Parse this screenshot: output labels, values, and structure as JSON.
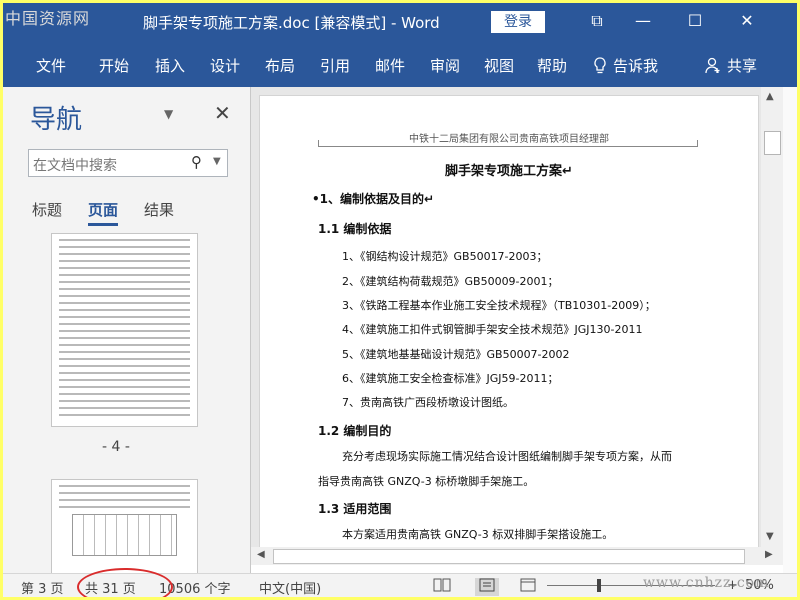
{
  "watermark_top": "中国资源网",
  "window": {
    "title": "脚手架专项施工方案.doc [兼容模式]  -  Word",
    "login": "登录",
    "buttons": {
      "restore": "⧉",
      "minimize": "—",
      "maximize": "☐",
      "close": "✕"
    }
  },
  "ribbon_tabs": [
    "文件",
    "开始",
    "插入",
    "设计",
    "布局",
    "引用",
    "邮件",
    "审阅",
    "视图",
    "帮助"
  ],
  "ribbon_right": {
    "tell_me": "告诉我",
    "share": "共享"
  },
  "nav": {
    "title": "导航",
    "search_placeholder": "在文档中搜索",
    "tabs": [
      "标题",
      "页面",
      "结果"
    ],
    "active_tab": "页面",
    "page_label": "- 4 -"
  },
  "document": {
    "header": "中铁十二局集团有限公司贵南高铁项目经理部",
    "title": "脚手架专项施工方案↵",
    "lines": [
      "•1、编制依据及目的↵",
      "1.1 编制依据",
      "1、《钢结构设计规范》GB50017-2003；",
      "2、《建筑结构荷载规范》GB50009-2001；",
      "3、《铁路工程基本作业施工安全技术规程》（TB10301-2009）；",
      "4、《建筑施工扣件式钢管脚手架安全技术规范》JGJ130-2011",
      "5、《建筑地基基础设计规范》GB50007-2002",
      "6、《建筑施工安全检查标准》JGJ59-2011；",
      "7、贵南高铁广西段桥墩设计图纸。",
      "1.2 编制目的",
      "充分考虑现场实际施工情况结合设计图纸编制脚手架专项方案，从而",
      "指导贵南高铁 GNZQ-3 标桥墩脚手架施工。",
      "1.3 适用范围",
      "本方案适用贵南高铁 GNZQ-3 标双排脚手架搭设施工。"
    ]
  },
  "status": {
    "page": "第 3 页",
    "total": "共 31 页",
    "words": "10506 个字",
    "lang": "中文(中国)",
    "zoom": "50%",
    "zoom_level": 0.5,
    "watermark": "www.cnhzz.com"
  },
  "colors": {
    "accent": "#2b579a",
    "highlight": "#d92c2c",
    "frame": "#ffff66"
  }
}
